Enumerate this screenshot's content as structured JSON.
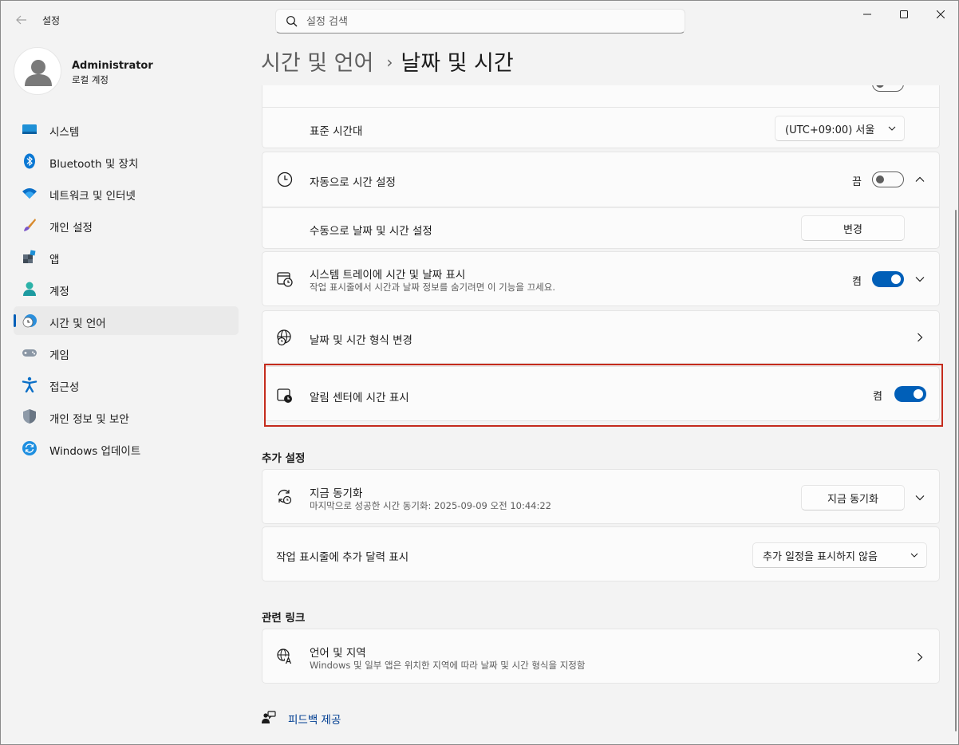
{
  "window": {
    "title": "설정"
  },
  "search": {
    "placeholder": "설정 검색"
  },
  "profile": {
    "name": "Administrator",
    "account_type": "로컬 계정"
  },
  "sidebar": {
    "items": [
      {
        "label": "시스템",
        "icon": "system-icon"
      },
      {
        "label": "Bluetooth 및 장치",
        "icon": "bluetooth-icon"
      },
      {
        "label": "네트워크 및 인터넷",
        "icon": "wifi-icon"
      },
      {
        "label": "개인 설정",
        "icon": "brush-icon"
      },
      {
        "label": "앱",
        "icon": "apps-icon"
      },
      {
        "label": "계정",
        "icon": "account-icon"
      },
      {
        "label": "시간 및 언어",
        "icon": "time-language-icon",
        "active": true
      },
      {
        "label": "게임",
        "icon": "gamepad-icon"
      },
      {
        "label": "접근성",
        "icon": "accessibility-icon"
      },
      {
        "label": "개인 정보 및 보안",
        "icon": "shield-icon"
      },
      {
        "label": "Windows 업데이트",
        "icon": "update-icon"
      }
    ]
  },
  "header": {
    "parent": "시간 및 언어",
    "separator": "›",
    "current": "날짜 및 시간"
  },
  "settings": {
    "timezone": {
      "label": "표준 시간대",
      "value": "(UTC+09:00) 서울"
    },
    "auto_time": {
      "label": "자동으로 시간 설정",
      "state": "끔"
    },
    "manual_time": {
      "label": "수동으로 날짜 및 시간 설정",
      "button": "변경"
    },
    "tray_time": {
      "label": "시스템 트레이에 시간 및 날짜 표시",
      "description": "작업 표시줄에서 시간과 날짜 정보를 숨기려면 이 기능을 끄세요.",
      "state": "켬"
    },
    "format": {
      "label": "날짜 및 시간 형식 변경"
    },
    "notification_time": {
      "label": "알림 센터에 시간 표시",
      "state": "켬"
    }
  },
  "additional": {
    "section_title": "추가 설정",
    "sync": {
      "label": "지금 동기화",
      "description": "마지막으로 성공한 시간 동기화: 2025-09-09 오전 10:44:22",
      "button": "지금 동기화"
    },
    "calendar": {
      "label": "작업 표시줄에 추가 달력 표시",
      "value": "추가 일정을 표시하지 않음"
    }
  },
  "related": {
    "section_title": "관련 링크",
    "language_region": {
      "label": "언어 및 지역",
      "description": "Windows 및 일부 앱은 위치한 지역에 따라 날짜 및 시간 형식을 지정함"
    }
  },
  "feedback": {
    "label": "피드백 제공"
  },
  "colors": {
    "accent": "#005fb8",
    "highlight_border": "#c42b1c"
  }
}
